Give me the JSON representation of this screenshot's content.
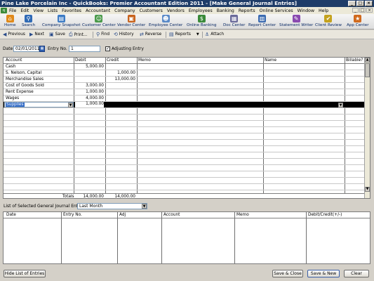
{
  "window": {
    "title": "Pine Lake Porcelain Inc  - QuickBooks: Premier Accountant Edition 2011 - [Make General Journal Entries]"
  },
  "menu": [
    "File",
    "Edit",
    "View",
    "Lists",
    "Favorites",
    "Accountant",
    "Company",
    "Customers",
    "Vendors",
    "Employees",
    "Banking",
    "Reports",
    "Online Services",
    "Window",
    "Help"
  ],
  "iconbar": [
    {
      "label": "Home",
      "icon": "home-icon",
      "color": "#e08a1a"
    },
    {
      "label": "Search",
      "icon": "search-icon",
      "color": "#2f6ab5"
    },
    {
      "label": "Company Snapshot",
      "icon": "snapshot-icon",
      "color": "#3c7bc4"
    },
    {
      "label": "Customer Center",
      "icon": "customer-icon",
      "color": "#4a9a4a"
    },
    {
      "label": "Vendor Center",
      "icon": "vendor-icon",
      "color": "#c8641e"
    },
    {
      "label": "Employee Center",
      "icon": "employee-icon",
      "color": "#5a8ac8"
    },
    {
      "label": "Online Banking",
      "icon": "bank-icon",
      "color": "#3a8a3a"
    },
    {
      "label": "Doc Center",
      "icon": "doc-icon",
      "color": "#6a6a9a"
    },
    {
      "label": "Report Center",
      "icon": "report-icon",
      "color": "#3a6ab0"
    },
    {
      "label": "Statement Writer",
      "icon": "statement-icon",
      "color": "#8a4ab0"
    },
    {
      "label": "Client Review",
      "icon": "review-icon",
      "color": "#c4a21e"
    },
    {
      "label": "App Center",
      "icon": "app-icon",
      "color": "#d06a1e"
    }
  ],
  "toolbar": {
    "previous": "Previous",
    "next": "Next",
    "save": "Save",
    "print": "Print...",
    "find": "Find",
    "history": "History",
    "reverse": "Reverse",
    "reports": "Reports",
    "attach": "Attach"
  },
  "form": {
    "date_label": "Date",
    "date_value": "02/01/2011",
    "entry_label": "Entry No.",
    "entry_value": "1",
    "adjusting_label": "Adjusting Entry",
    "adjusting_checked": "✓"
  },
  "grid": {
    "headers": {
      "account": "Account",
      "debit": "Debit",
      "credit": "Credit",
      "memo": "Memo",
      "name": "Name",
      "billable": "Billable?"
    },
    "rows": [
      {
        "account": "Cash",
        "debit": "5,000.00",
        "credit": ""
      },
      {
        "account": "S. Nelson, Capital",
        "debit": "",
        "credit": "1,000.00"
      },
      {
        "account": "Merchandise Sales",
        "debit": "",
        "credit": "13,000.00"
      },
      {
        "account": "Cost of Goods Sold",
        "debit": "3,000.00",
        "credit": ""
      },
      {
        "account": "Rent Expense",
        "debit": "1,000.00",
        "credit": ""
      },
      {
        "account": "Wages",
        "debit": "4,000.00",
        "credit": ""
      },
      {
        "account": "Supplies",
        "debit": "1,000.00",
        "credit": ""
      }
    ],
    "totals_label": "Totals",
    "total_debit": "14,000.00",
    "total_credit": "14,000.00"
  },
  "list": {
    "label": "List of Selected General Journal Entries:",
    "period": "Last Month",
    "headers": {
      "date": "Date",
      "entry": "Entry No.",
      "adj": "Adj",
      "account": "Account",
      "memo": "Memo",
      "amount": "Debit/Credit(+/-)"
    }
  },
  "buttons": {
    "hide_list": "Hide List of Entries",
    "save_close": "Save & Close",
    "save_new": "Save & New",
    "clear": "Clear"
  }
}
